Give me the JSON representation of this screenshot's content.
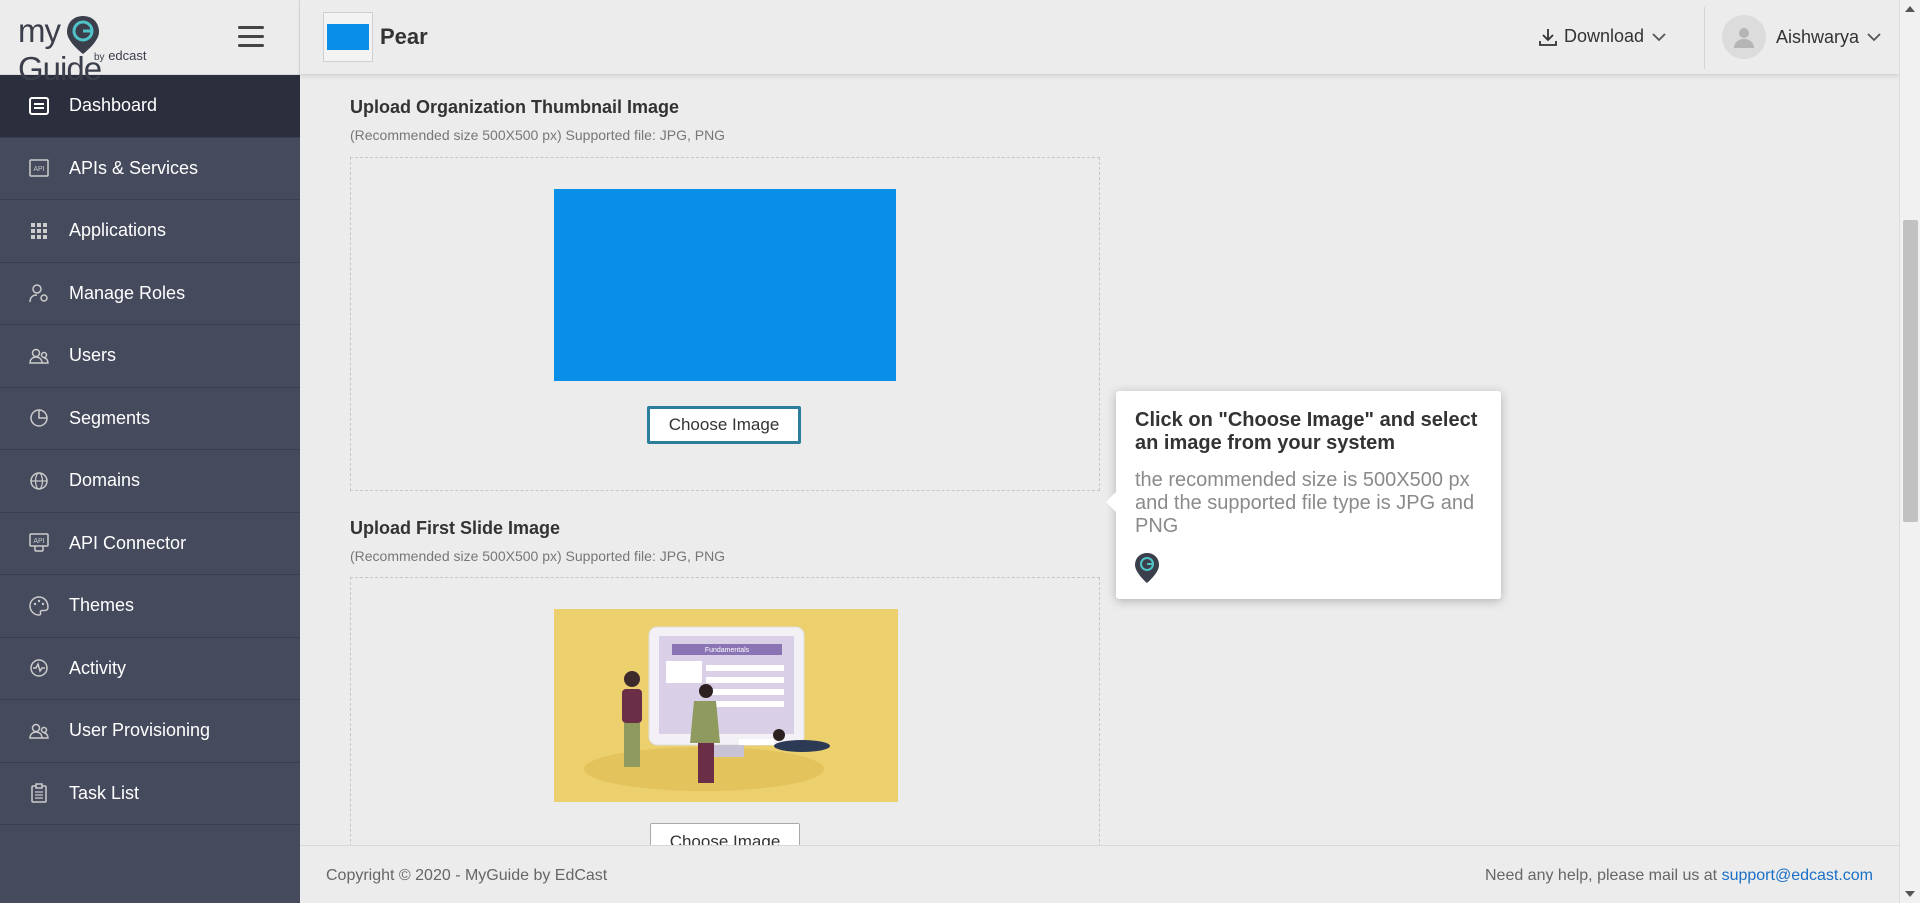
{
  "brand": {
    "logo_my": "my",
    "logo_guide": "Guide",
    "logo_by": "by",
    "logo_edcast": "edcast"
  },
  "sidebar": {
    "items": [
      {
        "label": "Dashboard",
        "icon": "dashboard-icon",
        "active": true
      },
      {
        "label": "APIs & Services",
        "icon": "api-icon"
      },
      {
        "label": "Applications",
        "icon": "grid-icon"
      },
      {
        "label": "Manage Roles",
        "icon": "user-gear-icon"
      },
      {
        "label": "Users",
        "icon": "users-icon"
      },
      {
        "label": "Segments",
        "icon": "pie-icon"
      },
      {
        "label": "Domains",
        "icon": "globe-icon"
      },
      {
        "label": "API Connector",
        "icon": "api-connector-icon"
      },
      {
        "label": "Themes",
        "icon": "palette-icon"
      },
      {
        "label": "Activity",
        "icon": "activity-icon"
      },
      {
        "label": "User Provisioning",
        "icon": "users-icon"
      },
      {
        "label": "Task List",
        "icon": "clipboard-icon"
      }
    ]
  },
  "header": {
    "org_name": "Pear",
    "download_label": "Download",
    "user_name": "Aishwarya"
  },
  "main": {
    "thumbnail_section": {
      "title": "Upload Organization Thumbnail Image",
      "hint": "(Recommended size 500X500 px) Supported file: JPG, PNG",
      "button_label": "Choose Image"
    },
    "first_slide_section": {
      "title": "Upload First Slide Image",
      "hint": "(Recommended size 500X500 px) Supported file: JPG, PNG",
      "button_label": "Choose Image",
      "image_text": "Fundamentals"
    }
  },
  "tooltip": {
    "title": "Click on \"Choose Image\" and select an image from your system",
    "body": "the recommended size is 500X500 px and the supported file type is JPG and PNG"
  },
  "footer": {
    "copyright": "Copyright © 2020 - MyGuide by EdCast",
    "help_text": "Need any help, please mail us at ",
    "help_email": "support@edcast.com"
  },
  "colors": {
    "sidebar_bg": "#454a5c",
    "sidebar_active": "#2b2e3d",
    "thumbnail_blue": "#0a8fe8",
    "highlight_border": "#2b7f9a",
    "slide_bg": "#ecd06d"
  }
}
